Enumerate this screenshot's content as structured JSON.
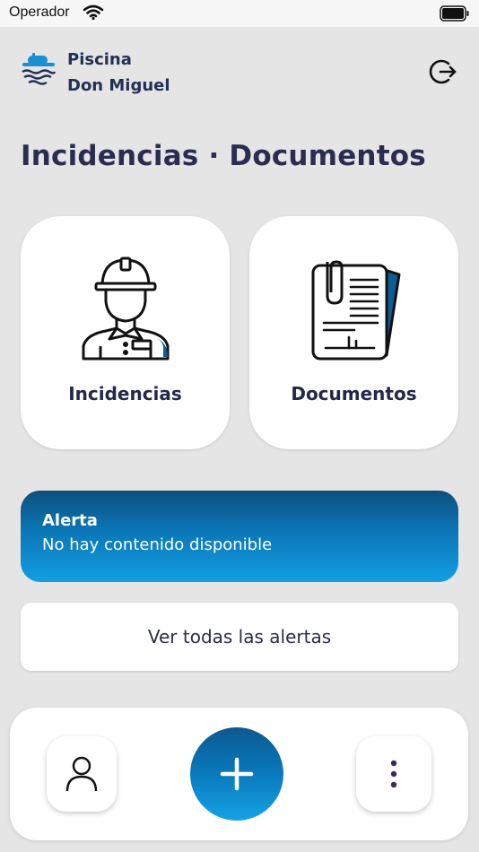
{
  "status_bar": {
    "carrier": "Operador"
  },
  "header": {
    "brand_line1": "Piscina",
    "brand_line2": "Don Miguel"
  },
  "page": {
    "title": "Incidencias · Documentos"
  },
  "cards": [
    {
      "label": "Incidencias",
      "icon": "worker-icon"
    },
    {
      "label": "Documentos",
      "icon": "documents-icon"
    }
  ],
  "alert": {
    "title": "Alerta",
    "text": "No hay contenido disponible"
  },
  "alerts_button": {
    "label": "Ver todas las alertas"
  },
  "bottom_nav": {
    "profile_icon": "user-icon",
    "add_icon": "plus-icon",
    "more_icon": "more-vertical-icon"
  },
  "colors": {
    "background": "#e5e5e5",
    "brand": "#233055",
    "accent": "#0a77b8",
    "accent_light": "#139ee2"
  }
}
